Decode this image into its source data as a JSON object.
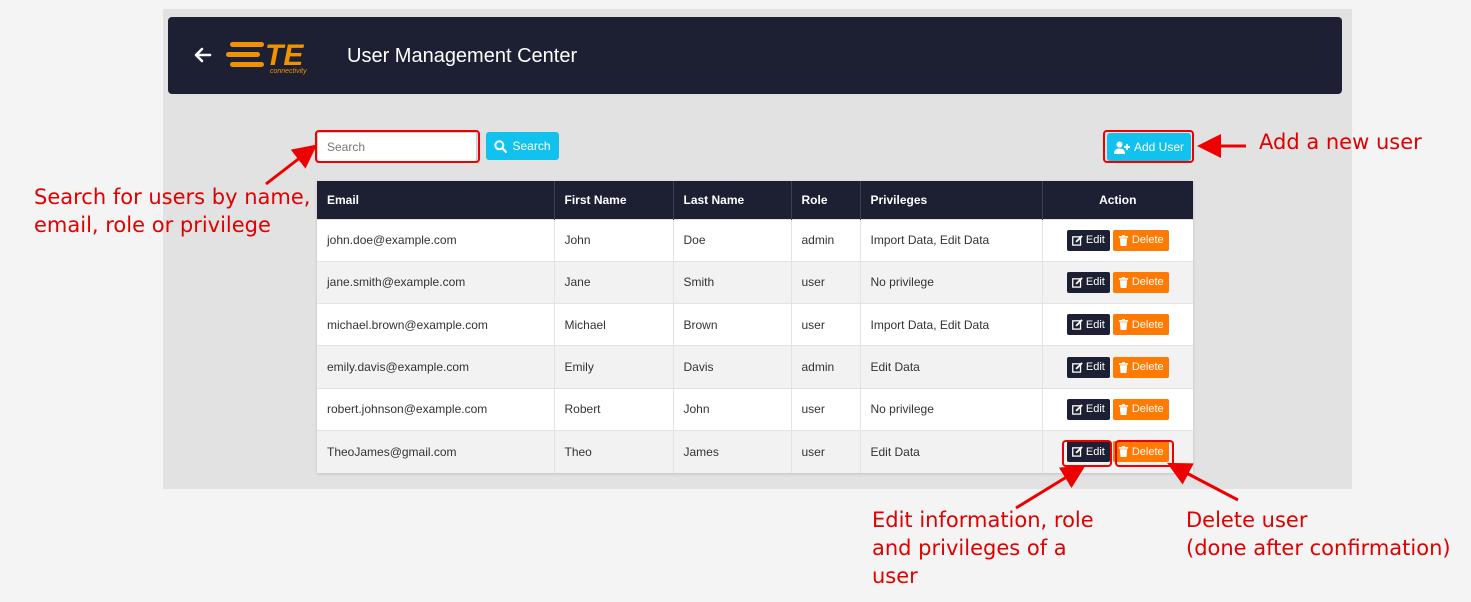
{
  "header": {
    "title": "User Management Center",
    "logo_text": "TE",
    "logo_subtext": "connectivity"
  },
  "toolbar": {
    "search_placeholder": "Search",
    "search_value": "",
    "search_label": "Search",
    "add_user_label": "Add User"
  },
  "table": {
    "columns": [
      "Email",
      "First Name",
      "Last Name",
      "Role",
      "Privileges",
      "Action"
    ],
    "rows": [
      {
        "email": "john.doe@example.com",
        "first": "John",
        "last": "Doe",
        "role": "admin",
        "privileges": "Import Data, Edit Data"
      },
      {
        "email": "jane.smith@example.com",
        "first": "Jane",
        "last": "Smith",
        "role": "user",
        "privileges": "No privilege"
      },
      {
        "email": "michael.brown@example.com",
        "first": "Michael",
        "last": "Brown",
        "role": "user",
        "privileges": "Import Data, Edit Data"
      },
      {
        "email": "emily.davis@example.com",
        "first": "Emily",
        "last": "Davis",
        "role": "admin",
        "privileges": "Edit Data"
      },
      {
        "email": "robert.johnson@example.com",
        "first": "Robert",
        "last": "John",
        "role": "user",
        "privileges": "No privilege"
      },
      {
        "email": "TheoJames@gmail.com",
        "first": "Theo",
        "last": "James",
        "role": "user",
        "privileges": "Edit Data"
      }
    ],
    "edit_label": "Edit",
    "delete_label": "Delete"
  },
  "annotations": {
    "search_note_line1": "Search for users by name,",
    "search_note_line2": "email, role or privilege",
    "add_note": "Add a new user",
    "edit_note_line1": "Edit information, role",
    "edit_note_line2": "and privileges of a",
    "edit_note_line3": "user",
    "delete_note_line1": "Delete user",
    "delete_note_line2": "(done after confirmation)"
  },
  "colors": {
    "header_bg": "#1c2032",
    "accent": "#12c2ee",
    "delete": "#ff7a00",
    "logo": "#f39200",
    "annotation": "#ee0000"
  }
}
